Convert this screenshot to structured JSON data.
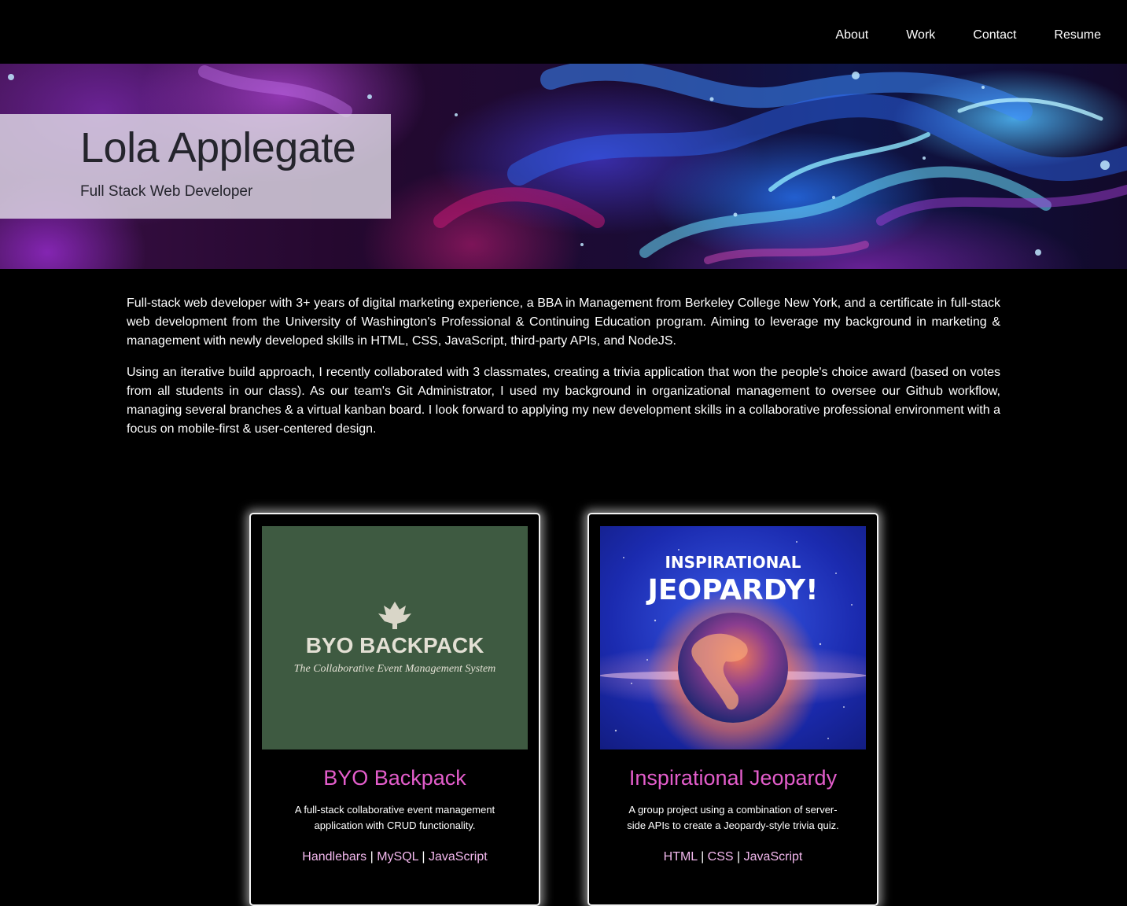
{
  "nav": {
    "items": [
      {
        "label": "About"
      },
      {
        "label": "Work"
      },
      {
        "label": "Contact"
      },
      {
        "label": "Resume"
      }
    ]
  },
  "hero": {
    "name": "Lola Applegate",
    "role": "Full Stack Web Developer"
  },
  "about": {
    "paragraphs": [
      "Full-stack web developer with 3+ years of digital marketing experience, a BBA in Management from Berkeley College New York, and a certificate in full-stack web development from the University of Washington's Professional & Continuing Education program. Aiming to leverage my background in marketing & management with newly developed skills in HTML, CSS, JavaScript, third-party APIs, and NodeJS.",
      "Using an iterative build approach, I recently collaborated with 3 classmates, creating a trivia application that won the people's choice award (based on votes from all students in our class). As our team's Git Administrator, I used my background in organizational management to oversee our Github workflow, managing several branches & a virtual kanban board. I look forward to applying my new development skills in a collaborative professional environment with a focus on mobile-first & user-centered design."
    ]
  },
  "projects": [
    {
      "image_title": "BYO BACKPACK",
      "image_subtitle": "The Collaborative Event Management System",
      "title": "BYO Backpack",
      "description": "A full-stack collaborative event management application with CRUD functionality.",
      "stack": [
        "Handlebars",
        "MySQL",
        "JavaScript"
      ],
      "separator": "|"
    },
    {
      "image_title_top": "INSPIRATIONAL",
      "image_title_bottom": "JEOPARDY!",
      "title": "Inspirational Jeopardy",
      "description": "A group project using a combination of server-side APIs to create a Jeopardy-style trivia quiz.",
      "stack": [
        "HTML",
        "CSS",
        "JavaScript"
      ],
      "separator": "|"
    }
  ],
  "colors": {
    "background": "#000000",
    "accent_title": "#e35dcb",
    "accent_links": "#f3b8ee",
    "byo_thumb": "#3e5a41"
  }
}
